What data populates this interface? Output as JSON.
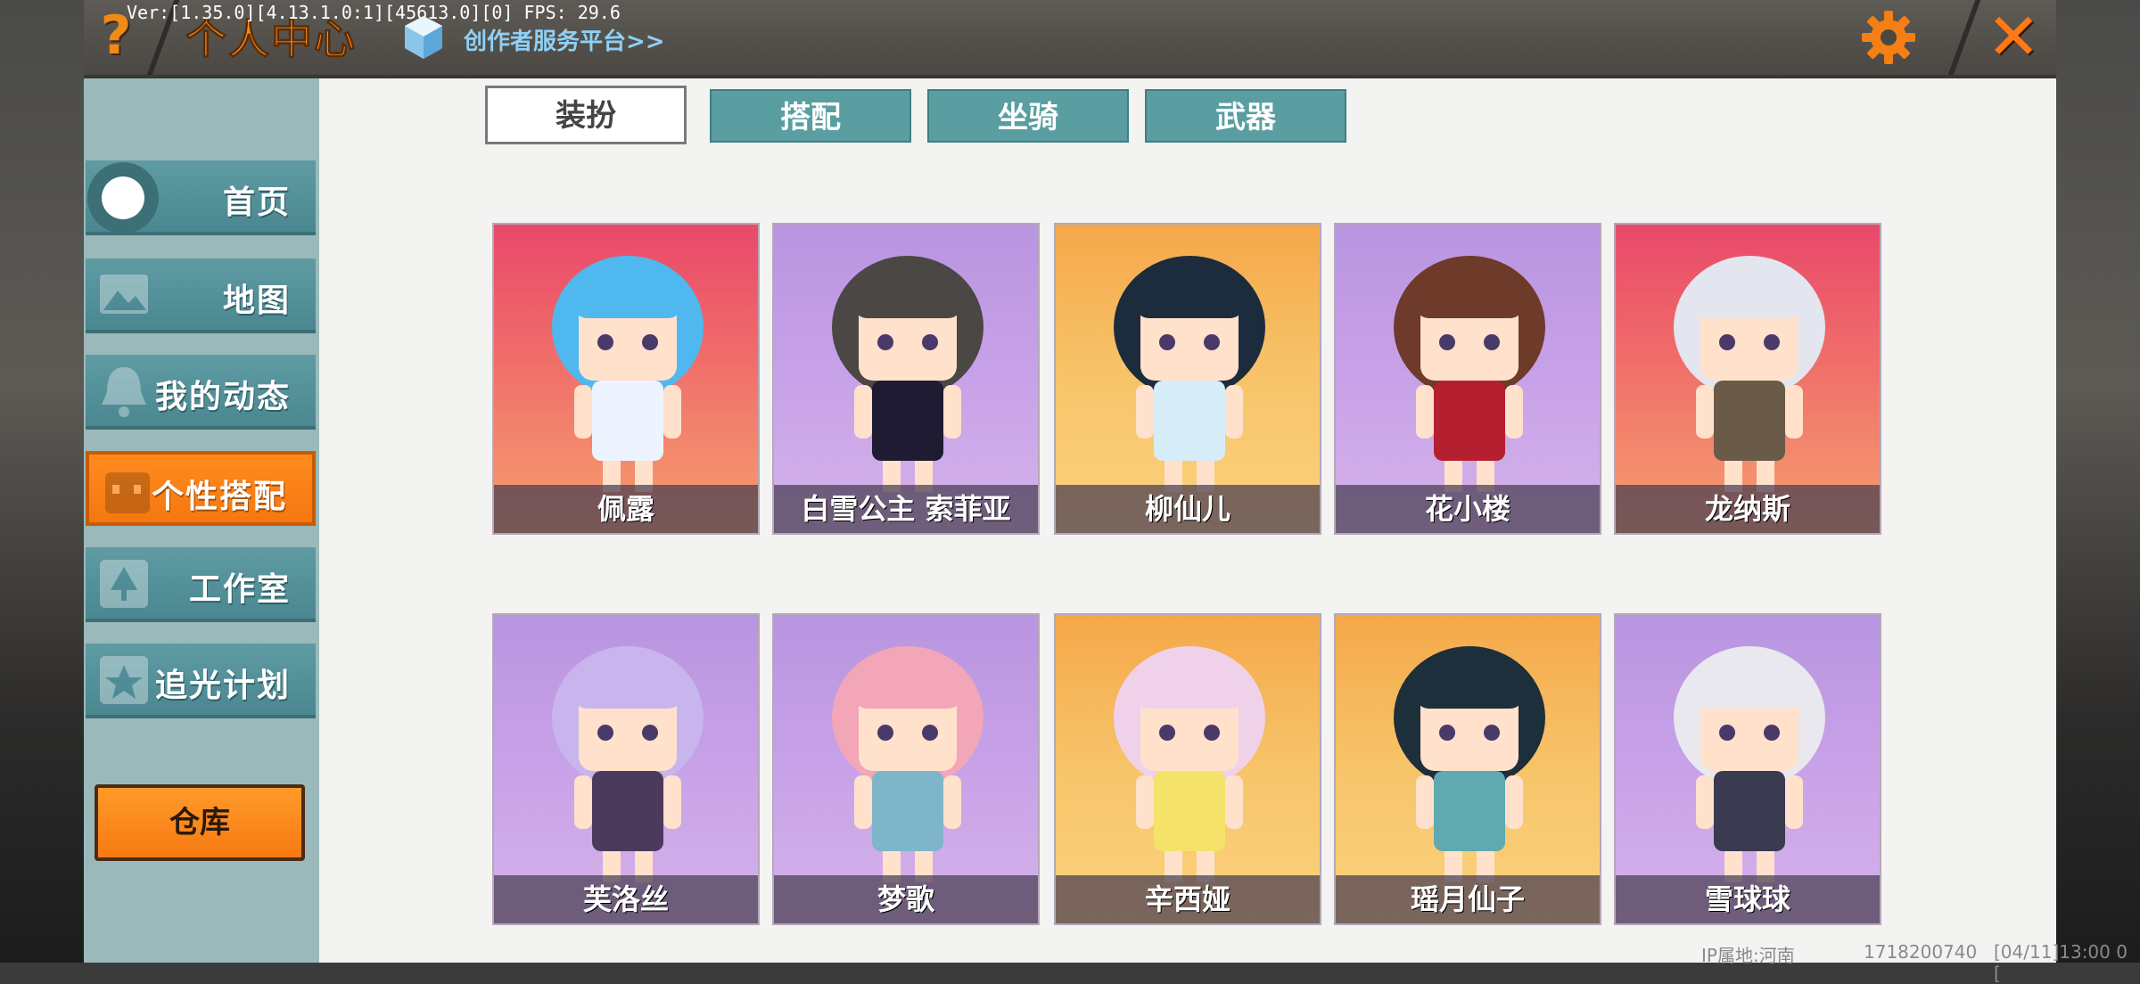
{
  "header": {
    "version": "Ver:[1.35.0][4.13.1.0:1][45613.0][0] FPS: 29.6",
    "title": "个人中心",
    "creator_link": "创作者服务平台>>"
  },
  "sidebar": {
    "items": [
      {
        "label": "首页"
      },
      {
        "label": "地图"
      },
      {
        "label": "我的动态"
      },
      {
        "label": "个性搭配",
        "active": true
      },
      {
        "label": "工作室"
      },
      {
        "label": "追光计划"
      }
    ],
    "warehouse": "仓库"
  },
  "tabs": [
    {
      "label": "装扮",
      "active": true
    },
    {
      "label": "搭配"
    },
    {
      "label": "坐骑"
    },
    {
      "label": "武器"
    }
  ],
  "skins": [
    {
      "name": "佩露",
      "bg": "red",
      "hair": "#4fb8ef",
      "outfit": "#eef4ff"
    },
    {
      "name": "白雪公主 索菲亚",
      "bg": "purple",
      "hair": "#4b4745",
      "outfit": "#1f1b33"
    },
    {
      "name": "柳仙儿",
      "bg": "orange",
      "hair": "#1c2c3c",
      "outfit": "#d7eef8"
    },
    {
      "name": "花小楼",
      "bg": "purple",
      "hair": "#6e3a2a",
      "outfit": "#b52030"
    },
    {
      "name": "龙纳斯",
      "bg": "red",
      "hair": "#e3e6ee",
      "outfit": "#6a5a48"
    },
    {
      "name": "芙洛丝",
      "bg": "purple",
      "hair": "#c9b5ee",
      "outfit": "#4b3a5c"
    },
    {
      "name": "梦歌",
      "bg": "purple",
      "hair": "#f2a6b8",
      "outfit": "#7fb5c9"
    },
    {
      "name": "辛西娅",
      "bg": "orange",
      "hair": "#efd2ea",
      "outfit": "#f5e26a"
    },
    {
      "name": "瑶月仙子",
      "bg": "orange",
      "hair": "#1c2f3a",
      "outfit": "#5fa9b0"
    },
    {
      "name": "雪球球",
      "bg": "purple",
      "hair": "#e8e8ee",
      "outfit": "#3a3a50"
    }
  ],
  "footer": {
    "ip": "IP属地:河南",
    "uid": "1718200740",
    "time": "[04/11]13:00 0 ["
  },
  "colors": {
    "accent": "#ff8a1c",
    "tab_teal": "#5a9ea1",
    "sidebar_bg": "#9bb9ba"
  }
}
